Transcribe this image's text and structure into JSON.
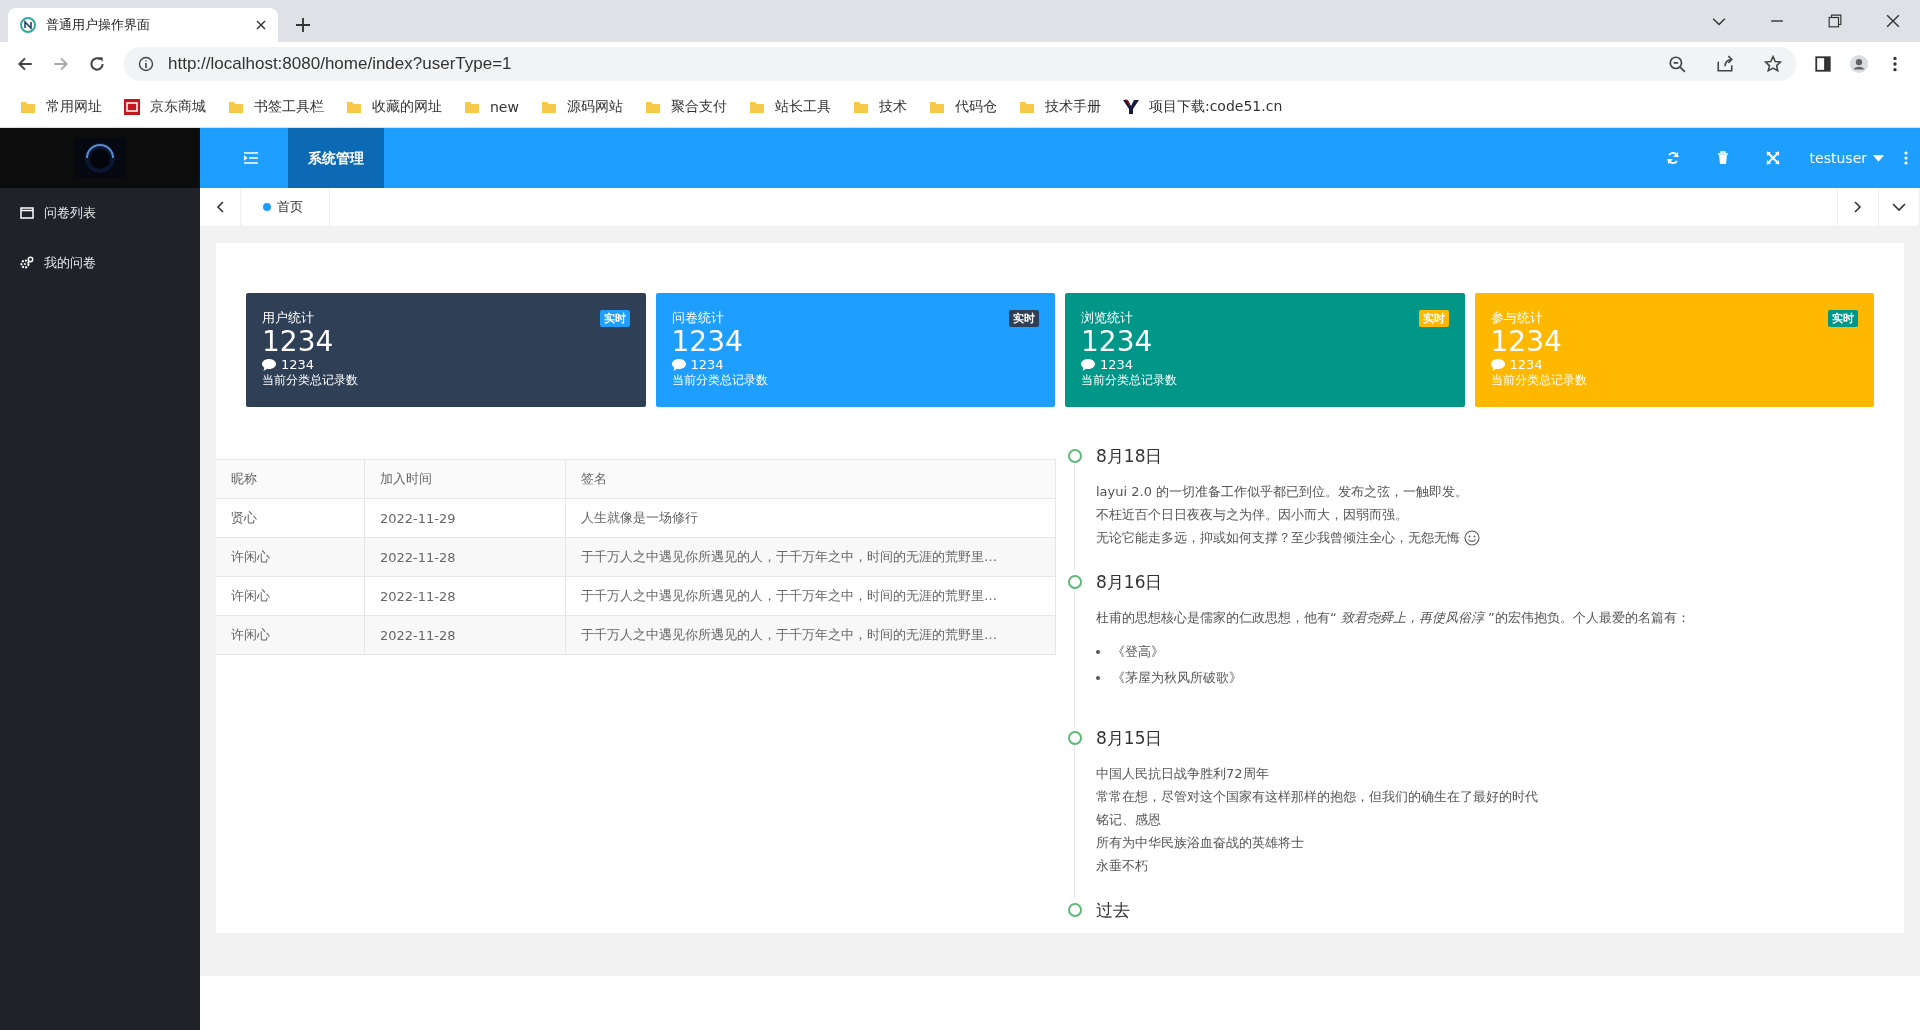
{
  "browser": {
    "tab_title": "普通用户操作界面",
    "url": "http://localhost:8080/home/index?userType=1",
    "bookmarks": [
      {
        "label": "常用网址",
        "kind": "folder"
      },
      {
        "label": "京东商城",
        "kind": "shop"
      },
      {
        "label": "书签工具栏",
        "kind": "folder"
      },
      {
        "label": "收藏的网址",
        "kind": "folder"
      },
      {
        "label": "new",
        "kind": "folder"
      },
      {
        "label": "源码网站",
        "kind": "folder"
      },
      {
        "label": "聚合支付",
        "kind": "folder"
      },
      {
        "label": "站长工具",
        "kind": "folder"
      },
      {
        "label": "技术",
        "kind": "folder"
      },
      {
        "label": "代码仓",
        "kind": "folder"
      },
      {
        "label": "技术手册",
        "kind": "folder"
      },
      {
        "label": "项目下载:code51.cn",
        "kind": "site"
      }
    ]
  },
  "sidebar": {
    "items": [
      {
        "label": "问卷列表",
        "selected": false
      },
      {
        "label": "我的问卷",
        "selected": false
      }
    ]
  },
  "header": {
    "nav": [
      {
        "label": "系统管理",
        "selected": true
      }
    ],
    "user": "testuser"
  },
  "tabs": [
    {
      "label": "首页",
      "selected": true
    }
  ],
  "stats": [
    {
      "title": "用户统计",
      "badge": "实时",
      "value": "1234",
      "count": "1234",
      "note": "当前分类总记录数",
      "color": "#2f4056"
    },
    {
      "title": "问卷统计",
      "badge": "实时",
      "value": "1234",
      "count": "1234",
      "note": "当前分类总记录数",
      "color": "#1e9fff"
    },
    {
      "title": "浏览统计",
      "badge": "实时",
      "value": "1234",
      "count": "1234",
      "note": "当前分类总记录数",
      "color": "#009688"
    },
    {
      "title": "参与统计",
      "badge": "实时",
      "value": "1234",
      "count": "1234",
      "note": "当前分类总记录数",
      "color": "#ffb800"
    }
  ],
  "table": {
    "columns": [
      "昵称",
      "加入时间",
      "签名"
    ],
    "rows": [
      [
        "贤心",
        "2022-11-29",
        "人生就像是一场修行"
      ],
      [
        "许闲心",
        "2022-11-28",
        "于千万人之中遇见你所遇见的人，于千万年之中，时间的无涯的荒野里…"
      ],
      [
        "许闲心",
        "2022-11-28",
        "于千万人之中遇见你所遇见的人，于千万年之中，时间的无涯的荒野里…"
      ],
      [
        "许闲心",
        "2022-11-28",
        "于千万人之中遇见你所遇见的人，于千万年之中，时间的无涯的荒野里…"
      ]
    ]
  },
  "timeline": [
    {
      "title": "8月18日",
      "blocks": [
        {
          "kind": "lines",
          "lines": [
            "layui 2.0 的一切准备工作似乎都已到位。发布之弦，一触即发。",
            "不枉近百个日日夜夜与之为伴。因小而大，因弱而强。",
            "无论它能走多远，抑或如何支撑？至少我曾倾注全心，无怨无悔"
          ],
          "smiley": true
        }
      ]
    },
    {
      "title": "8月16日",
      "blocks": [
        {
          "kind": "lines",
          "lines": [
            "杜甫的思想核心是儒家的仁政思想，他有“ *致君尧舜上，再使风俗淳* ”的宏伟抱负。个人最爱的名篇有："
          ],
          "smiley": false
        },
        {
          "kind": "list",
          "lines": [
            "《登高》",
            "《茅屋为秋风所破歌》"
          ]
        }
      ]
    },
    {
      "title": "8月15日",
      "blocks": [
        {
          "kind": "lines",
          "lines": [
            "中国人民抗日战争胜利72周年",
            "常常在想，尽管对这个国家有这样那样的抱怨，但我们的确生在了最好的时代",
            "铭记、感恩",
            "所有为中华民族浴血奋战的英雄将士",
            "永垂不朽"
          ],
          "smiley": false
        }
      ]
    },
    {
      "title": "过去"
    }
  ]
}
